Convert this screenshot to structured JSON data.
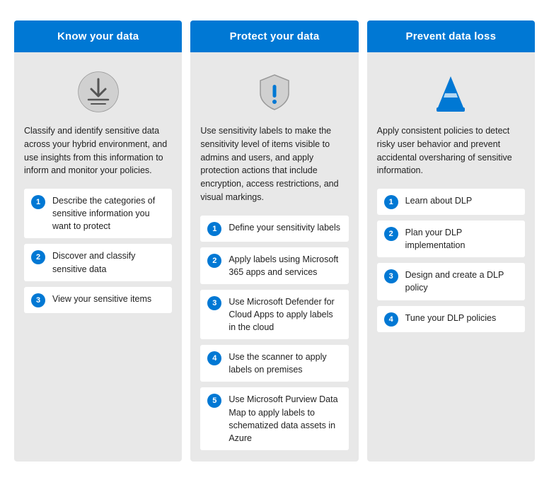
{
  "columns": [
    {
      "id": "know-your-data",
      "header": "Know your data",
      "description": "Classify and identify sensitive data across your hybrid environment, and use insights from this information to inform and monitor your policies.",
      "icon": "data-classify",
      "steps": [
        {
          "number": "1",
          "text": "Describe the categories of sensitive information you want to protect"
        },
        {
          "number": "2",
          "text": "Discover and classify sensitive data"
        },
        {
          "number": "3",
          "text": "View your sensitive items"
        }
      ]
    },
    {
      "id": "protect-your-data",
      "header": "Protect your data",
      "description": "Use sensitivity labels to make the sensitivity level of items visible to admins and users, and apply protection actions that include encryption, access restrictions, and visual markings.",
      "icon": "shield-alert",
      "steps": [
        {
          "number": "1",
          "text": "Define your sensitivity labels"
        },
        {
          "number": "2",
          "text": "Apply labels using Microsoft 365 apps and services"
        },
        {
          "number": "3",
          "text": "Use Microsoft Defender for Cloud Apps to apply labels in the cloud"
        },
        {
          "number": "4",
          "text": "Use the scanner to apply labels on premises"
        },
        {
          "number": "5",
          "text": "Use Microsoft Purview Data Map to apply labels to schematized data assets in Azure"
        }
      ]
    },
    {
      "id": "prevent-data-loss",
      "header": "Prevent data loss",
      "description": "Apply consistent policies to detect risky user behavior and prevent accidental oversharing of sensitive information.",
      "icon": "cone-warning",
      "steps": [
        {
          "number": "1",
          "text": "Learn about DLP"
        },
        {
          "number": "2",
          "text": "Plan your DLP implementation"
        },
        {
          "number": "3",
          "text": "Design and create a DLP policy"
        },
        {
          "number": "4",
          "text": "Tune your DLP policies"
        }
      ]
    }
  ]
}
